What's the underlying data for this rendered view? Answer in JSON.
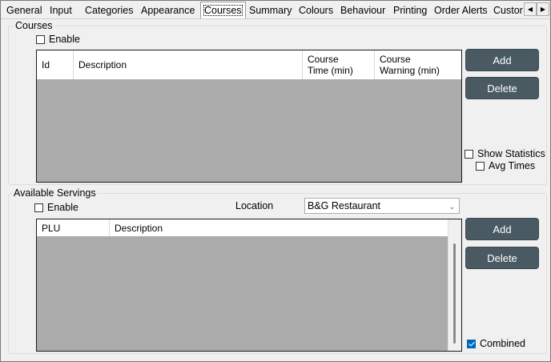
{
  "tabs": [
    "General",
    "Input",
    "Categories",
    "Appearance",
    "Courses",
    "Summary",
    "Colours",
    "Behaviour",
    "Printing",
    "Order Alerts",
    "Custor"
  ],
  "selected_tab": "Courses",
  "tab_scroll": {
    "left": "◀",
    "right": "▶"
  },
  "courses": {
    "group_title": "Courses",
    "enable_label": "Enable",
    "enable_checked": false,
    "columns": [
      "Id",
      "Description",
      "Course\nTime (min)",
      "Course\nWarning (min)"
    ],
    "add_label": "Add",
    "delete_label": "Delete",
    "show_statistics_label": "Show Statistics",
    "avg_times_label": "Avg Times"
  },
  "servings": {
    "group_title": "Available Servings",
    "enable_label": "Enable",
    "enable_checked": false,
    "location_label": "Location",
    "location_value": "B&G Restaurant",
    "columns": [
      "PLU",
      "Description"
    ],
    "add_label": "Add",
    "delete_label": "Delete",
    "combined_label": "Combined",
    "combined_checked": true
  },
  "colors": {
    "button": "#4a5a63",
    "grid_empty": "#ababab",
    "checked": "#0067c0"
  }
}
